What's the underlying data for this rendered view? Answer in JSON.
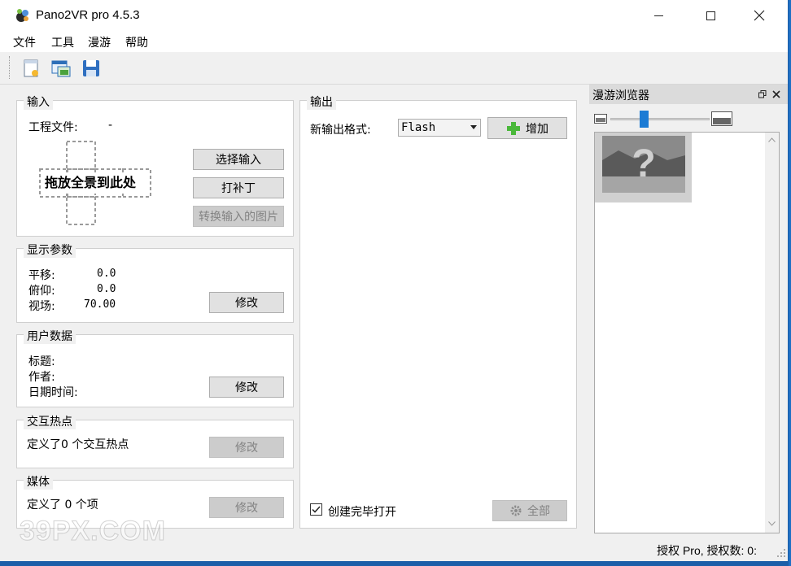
{
  "window": {
    "title": "Pano2VR pro 4.5.3"
  },
  "menu": [
    "文件",
    "工具",
    "漫游",
    "帮助"
  ],
  "toolbar": {
    "icons": [
      "new-project-icon",
      "open-project-icon",
      "save-icon"
    ]
  },
  "input": {
    "group_title": "输入",
    "project_file_label": "工程文件:",
    "project_file_value": "-",
    "drop_text": "拖放全景到此处",
    "select_input": "选择输入",
    "patch": "打补丁",
    "convert": "转换输入的图片"
  },
  "display": {
    "group_title": "显示参数",
    "pan_label": "平移:",
    "pan_value": "0.0",
    "tilt_label": "俯仰:",
    "tilt_value": "0.0",
    "fov_label": "视场:",
    "fov_value": "70.00",
    "modify": "修改"
  },
  "userdata": {
    "group_title": "用户数据",
    "title_label": "标题:",
    "author_label": "作者:",
    "datetime_label": "日期时间:",
    "modify": "修改"
  },
  "hotspots": {
    "group_title": "交互热点",
    "summary": "定义了0 个交互热点",
    "modify": "修改"
  },
  "media": {
    "group_title": "媒体",
    "summary": "定义了 0 个项",
    "modify": "修改"
  },
  "output": {
    "group_title": "输出",
    "format_label": "新输出格式:",
    "format_value": "Flash",
    "add": "增加",
    "open_after": "创建完毕打开",
    "open_after_checked": true,
    "all": "全部"
  },
  "tour_browser": {
    "title": "漫游浏览器"
  },
  "status": {
    "text": "授权 Pro, 授权数: 0:"
  },
  "watermark": "39PX.COM",
  "colors": {
    "window_bg": "#f0f0f0",
    "desktop": "#1c5ea8",
    "slider": "#1c7bd4"
  }
}
